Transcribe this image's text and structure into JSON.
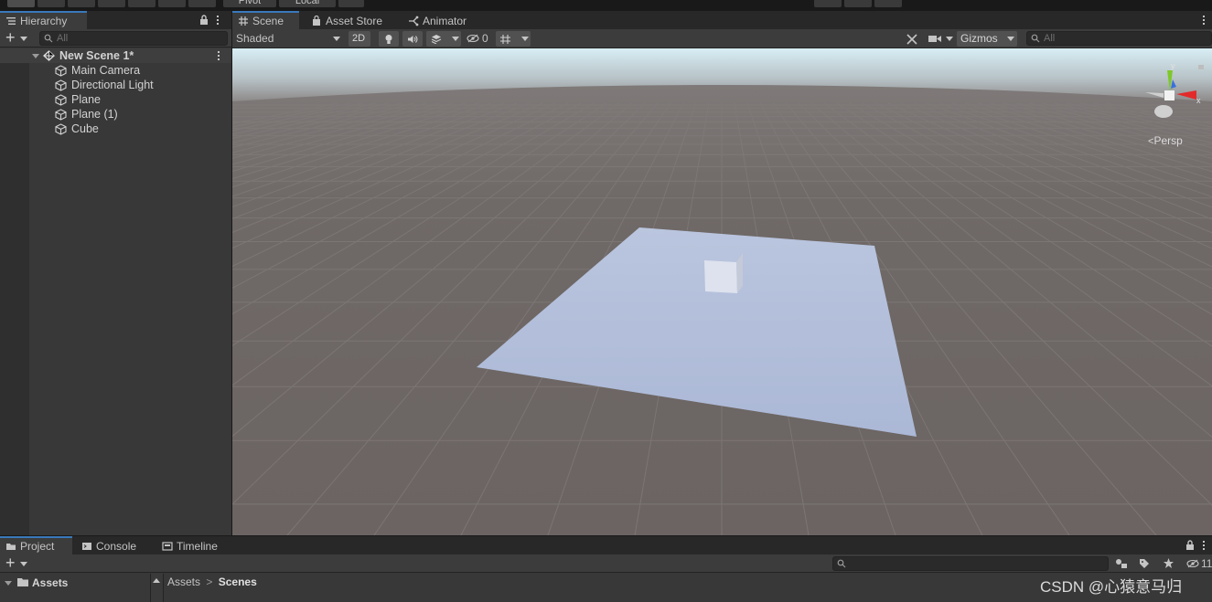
{
  "toolbar": {
    "pivot_label": "Pivot",
    "local_label": "Local"
  },
  "hierarchy": {
    "tab_label": "Hierarchy",
    "add_label": "+",
    "search_placeholder": "All",
    "scene_name": "New Scene 1*",
    "items": [
      {
        "label": "Main Camera",
        "icon": "cube-icon"
      },
      {
        "label": "Directional Light",
        "icon": "cube-icon"
      },
      {
        "label": "Plane",
        "icon": "cube-icon"
      },
      {
        "label": "Plane (1)",
        "icon": "cube-icon"
      },
      {
        "label": "Cube",
        "icon": "cube-icon"
      }
    ]
  },
  "scene": {
    "tabs": [
      {
        "label": "Scene",
        "icon": "grid-icon"
      },
      {
        "label": "Asset Store",
        "icon": "bag-icon"
      },
      {
        "label": "Animator",
        "icon": "animator-icon"
      }
    ],
    "shading_mode": "Shaded",
    "mode_2d": "2D",
    "hidden_count": "0",
    "gizmos_label": "Gizmos",
    "search_placeholder": "All",
    "persp_label": "Persp",
    "axis_x": "x",
    "axis_y": "y"
  },
  "project": {
    "tabs": [
      {
        "label": "Project",
        "icon": "folder-icon"
      },
      {
        "label": "Console",
        "icon": "console-icon"
      },
      {
        "label": "Timeline",
        "icon": "timeline-icon"
      }
    ],
    "add_label": "+",
    "hidden_count": "11",
    "tree_root": "Assets",
    "breadcrumb": [
      "Assets",
      "Scenes"
    ]
  },
  "watermark": "CSDN @心猿意马归",
  "colors": {
    "panel": "#383838",
    "tab_active_accent": "#3a79bb",
    "ground": "#6e6866",
    "sky": "#d9eef4",
    "plane": "#b4c0dc"
  }
}
